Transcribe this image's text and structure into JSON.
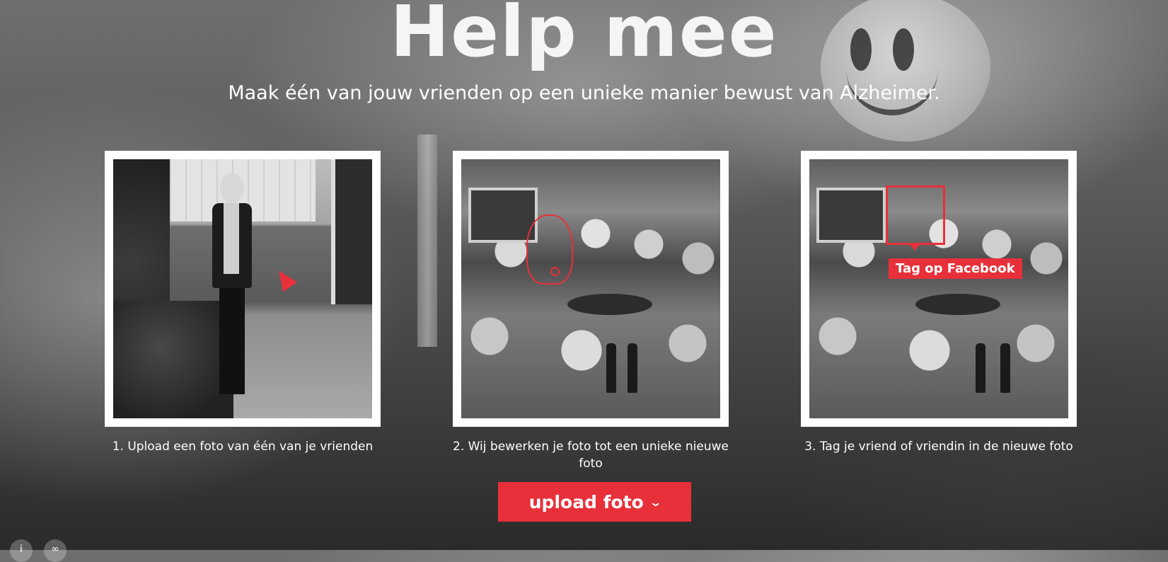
{
  "hero": {
    "title": "Help mee",
    "subtitle": "Maak één van jouw vrienden op een unieke manier bewust van Alzheimer."
  },
  "steps": [
    {
      "caption": "1. Upload een foto van één van je vrienden"
    },
    {
      "caption": "2. Wij bewerken je foto tot een unieke nieuwe foto"
    },
    {
      "caption": "3. Tag je vriend of vriendin in de nieuwe foto",
      "tag_label": "Tag op Facebook"
    }
  ],
  "upload_button": {
    "label": "upload foto",
    "icon": "chevron-down-icon"
  },
  "colors": {
    "accent": "#e8303a",
    "text": "#ffffff",
    "frame": "#ffffff"
  },
  "social_icons": [
    "info-icon",
    "link-icon"
  ]
}
